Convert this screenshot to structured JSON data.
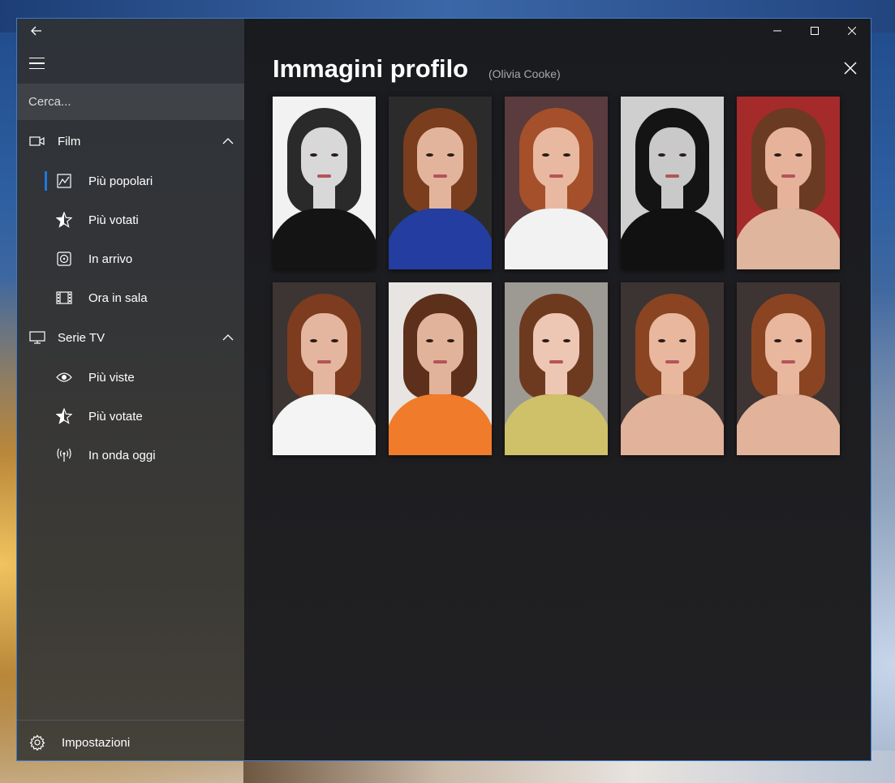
{
  "sidebar": {
    "search_placeholder": "Cerca...",
    "groups": [
      {
        "label": "Film",
        "items": [
          {
            "label": "Più popolari"
          },
          {
            "label": "Più votati"
          },
          {
            "label": "In arrivo"
          },
          {
            "label": "Ora in sala"
          }
        ]
      },
      {
        "label": "Serie TV",
        "items": [
          {
            "label": "Più viste"
          },
          {
            "label": "Più votate"
          },
          {
            "label": "In onda oggi"
          }
        ]
      }
    ],
    "settings_label": "Impostazioni"
  },
  "main": {
    "title": "Immagini profilo",
    "subtitle": "(Olivia Cooke)",
    "photos": [
      {
        "bg": "#f2f2f2",
        "hair": "#2a2a2a",
        "skin": "#d8d8d8",
        "top": "#141414"
      },
      {
        "bg": "#2b2b2b",
        "hair": "#7a3d1e",
        "skin": "#e3b49c",
        "top": "#233ea0"
      },
      {
        "bg": "#5a3b3e",
        "hair": "#a5502a",
        "skin": "#e8b9a0",
        "top": "#f2f2f2"
      },
      {
        "bg": "#cfcfcf",
        "hair": "#141414",
        "skin": "#c9c9c9",
        "top": "#111111"
      },
      {
        "bg": "#a52a2a",
        "hair": "#6b3a22",
        "skin": "#e6b39a",
        "top": "#e0b59d"
      },
      {
        "bg": "#3c3534",
        "hair": "#7d3c1f",
        "skin": "#e5b69f",
        "top": "#f4f4f4"
      },
      {
        "bg": "#e8e4e1",
        "hair": "#5d301b",
        "skin": "#e2b39b",
        "top": "#f07b2a"
      },
      {
        "bg": "#9d9a94",
        "hair": "#6e3a1f",
        "skin": "#edc7b3",
        "top": "#cfc06a"
      },
      {
        "bg": "#3b3433",
        "hair": "#8a4422",
        "skin": "#e8b79e",
        "top": "#e2b29a"
      },
      {
        "bg": "#3d3433",
        "hair": "#8a4422",
        "skin": "#e8b79e",
        "top": "#e2b29a"
      }
    ]
  },
  "colors": {
    "accent": "#1e78e0",
    "window_border": "#3a7ccc"
  }
}
